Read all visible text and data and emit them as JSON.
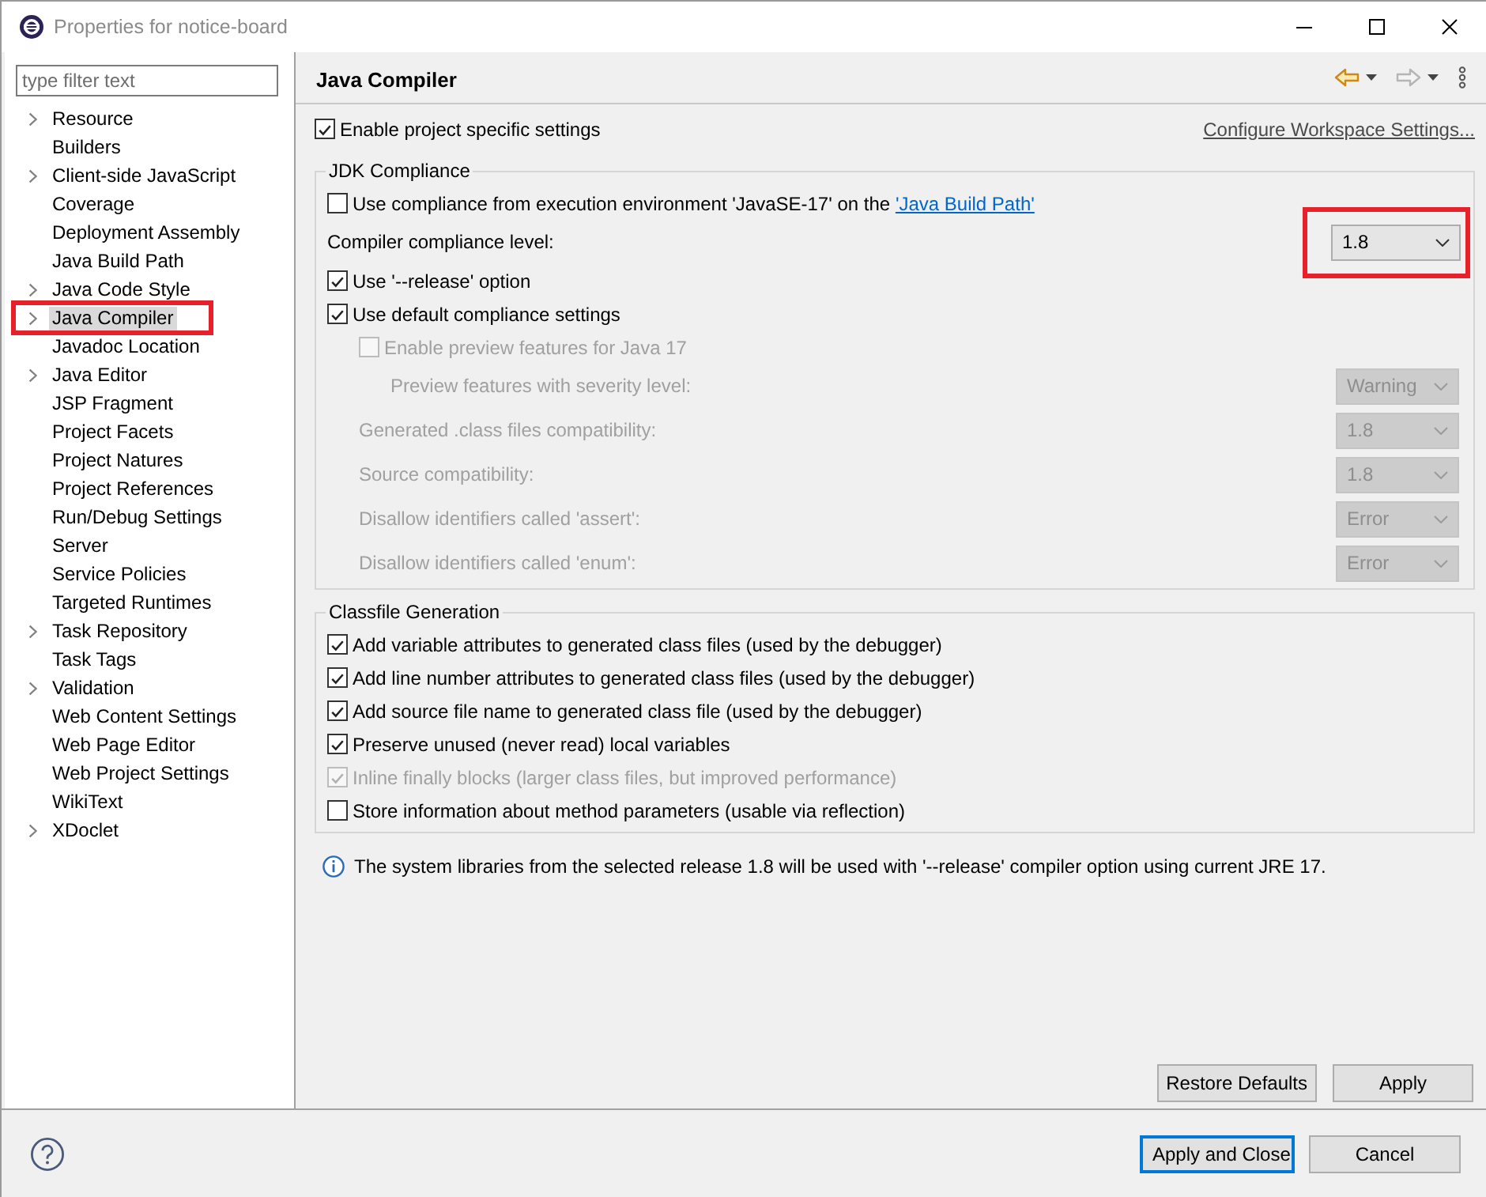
{
  "window": {
    "title": "Properties for notice-board"
  },
  "filter": {
    "placeholder": "type filter text"
  },
  "tree": [
    {
      "label": "Resource",
      "expandable": true,
      "selected": false,
      "highlighted": false
    },
    {
      "label": "Builders",
      "expandable": false,
      "selected": false,
      "highlighted": false
    },
    {
      "label": "Client-side JavaScript",
      "expandable": true,
      "selected": false,
      "highlighted": false
    },
    {
      "label": "Coverage",
      "expandable": false,
      "selected": false,
      "highlighted": false
    },
    {
      "label": "Deployment Assembly",
      "expandable": false,
      "selected": false,
      "highlighted": false
    },
    {
      "label": "Java Build Path",
      "expandable": false,
      "selected": false,
      "highlighted": false
    },
    {
      "label": "Java Code Style",
      "expandable": true,
      "selected": false,
      "highlighted": false
    },
    {
      "label": "Java Compiler",
      "expandable": true,
      "selected": true,
      "highlighted": true
    },
    {
      "label": "Javadoc Location",
      "expandable": false,
      "selected": false,
      "highlighted": false
    },
    {
      "label": "Java Editor",
      "expandable": true,
      "selected": false,
      "highlighted": false
    },
    {
      "label": "JSP Fragment",
      "expandable": false,
      "selected": false,
      "highlighted": false
    },
    {
      "label": "Project Facets",
      "expandable": false,
      "selected": false,
      "highlighted": false
    },
    {
      "label": "Project Natures",
      "expandable": false,
      "selected": false,
      "highlighted": false
    },
    {
      "label": "Project References",
      "expandable": false,
      "selected": false,
      "highlighted": false
    },
    {
      "label": "Run/Debug Settings",
      "expandable": false,
      "selected": false,
      "highlighted": false
    },
    {
      "label": "Server",
      "expandable": false,
      "selected": false,
      "highlighted": false
    },
    {
      "label": "Service Policies",
      "expandable": false,
      "selected": false,
      "highlighted": false
    },
    {
      "label": "Targeted Runtimes",
      "expandable": false,
      "selected": false,
      "highlighted": false
    },
    {
      "label": "Task Repository",
      "expandable": true,
      "selected": false,
      "highlighted": false
    },
    {
      "label": "Task Tags",
      "expandable": false,
      "selected": false,
      "highlighted": false
    },
    {
      "label": "Validation",
      "expandable": true,
      "selected": false,
      "highlighted": false
    },
    {
      "label": "Web Content Settings",
      "expandable": false,
      "selected": false,
      "highlighted": false
    },
    {
      "label": "Web Page Editor",
      "expandable": false,
      "selected": false,
      "highlighted": false
    },
    {
      "label": "Web Project Settings",
      "expandable": false,
      "selected": false,
      "highlighted": false
    },
    {
      "label": "WikiText",
      "expandable": false,
      "selected": false,
      "highlighted": false
    },
    {
      "label": "XDoclet",
      "expandable": true,
      "selected": false,
      "highlighted": false
    }
  ],
  "page": {
    "title": "Java Compiler",
    "enable_specific": {
      "label": "Enable project specific settings",
      "checked": true
    },
    "configure_link": "Configure Workspace Settings...",
    "groups": [
      {
        "title": "JDK Compliance",
        "rows": [
          {
            "kind": "checkbox",
            "label": "Use compliance from execution environment 'JavaSE-17' on the ",
            "link": "'Java Build Path'",
            "checked": false,
            "disabled": false
          },
          {
            "kind": "combo",
            "label": "Compiler compliance level:",
            "value": "1.8",
            "disabled": false,
            "highlighted": true
          },
          {
            "kind": "checkbox",
            "label": "Use '--release' option",
            "checked": true,
            "disabled": false
          },
          {
            "kind": "checkbox",
            "label": "Use default compliance settings",
            "checked": true,
            "disabled": false,
            "children": [
              {
                "kind": "checkbox",
                "label": "Enable preview features for Java 17",
                "checked": false,
                "disabled": true,
                "children": [
                  {
                    "kind": "combo",
                    "label": "Preview features with severity level:",
                    "value": "Warning",
                    "disabled": true,
                    "highlighted": false
                  }
                ]
              },
              {
                "kind": "combo",
                "label": "Generated .class files compatibility:",
                "value": "1.8",
                "disabled": true,
                "highlighted": false
              },
              {
                "kind": "combo",
                "label": "Source compatibility:",
                "value": "1.8",
                "disabled": true,
                "highlighted": false
              },
              {
                "kind": "combo",
                "label": "Disallow identifiers called 'assert':",
                "value": "Error",
                "disabled": true,
                "highlighted": false
              },
              {
                "kind": "combo",
                "label": "Disallow identifiers called 'enum':",
                "value": "Error",
                "disabled": true,
                "highlighted": false
              }
            ]
          }
        ]
      },
      {
        "title": "Classfile Generation",
        "rows": [
          {
            "kind": "checkbox",
            "label": "Add variable attributes to generated class files (used by the debugger)",
            "checked": true,
            "disabled": false
          },
          {
            "kind": "checkbox",
            "label": "Add line number attributes to generated class files (used by the debugger)",
            "checked": true,
            "disabled": false
          },
          {
            "kind": "checkbox",
            "label": "Add source file name to generated class file (used by the debugger)",
            "checked": true,
            "disabled": false
          },
          {
            "kind": "checkbox",
            "label": "Preserve unused (never read) local variables",
            "checked": true,
            "disabled": false
          },
          {
            "kind": "checkbox",
            "label": "Inline finally blocks (larger class files, but improved performance)",
            "checked": true,
            "disabled": true
          },
          {
            "kind": "checkbox",
            "label": "Store information about method parameters (usable via reflection)",
            "checked": false,
            "disabled": false
          }
        ]
      }
    ],
    "info": "The system libraries from the selected release 1.8 will be used with '--release' compiler option using current JRE 17.",
    "page_buttons": [
      "Restore Defaults",
      "Apply"
    ]
  },
  "dialog_buttons": [
    {
      "label": "Apply and Close",
      "default": true
    },
    {
      "label": "Cancel",
      "default": false
    }
  ]
}
